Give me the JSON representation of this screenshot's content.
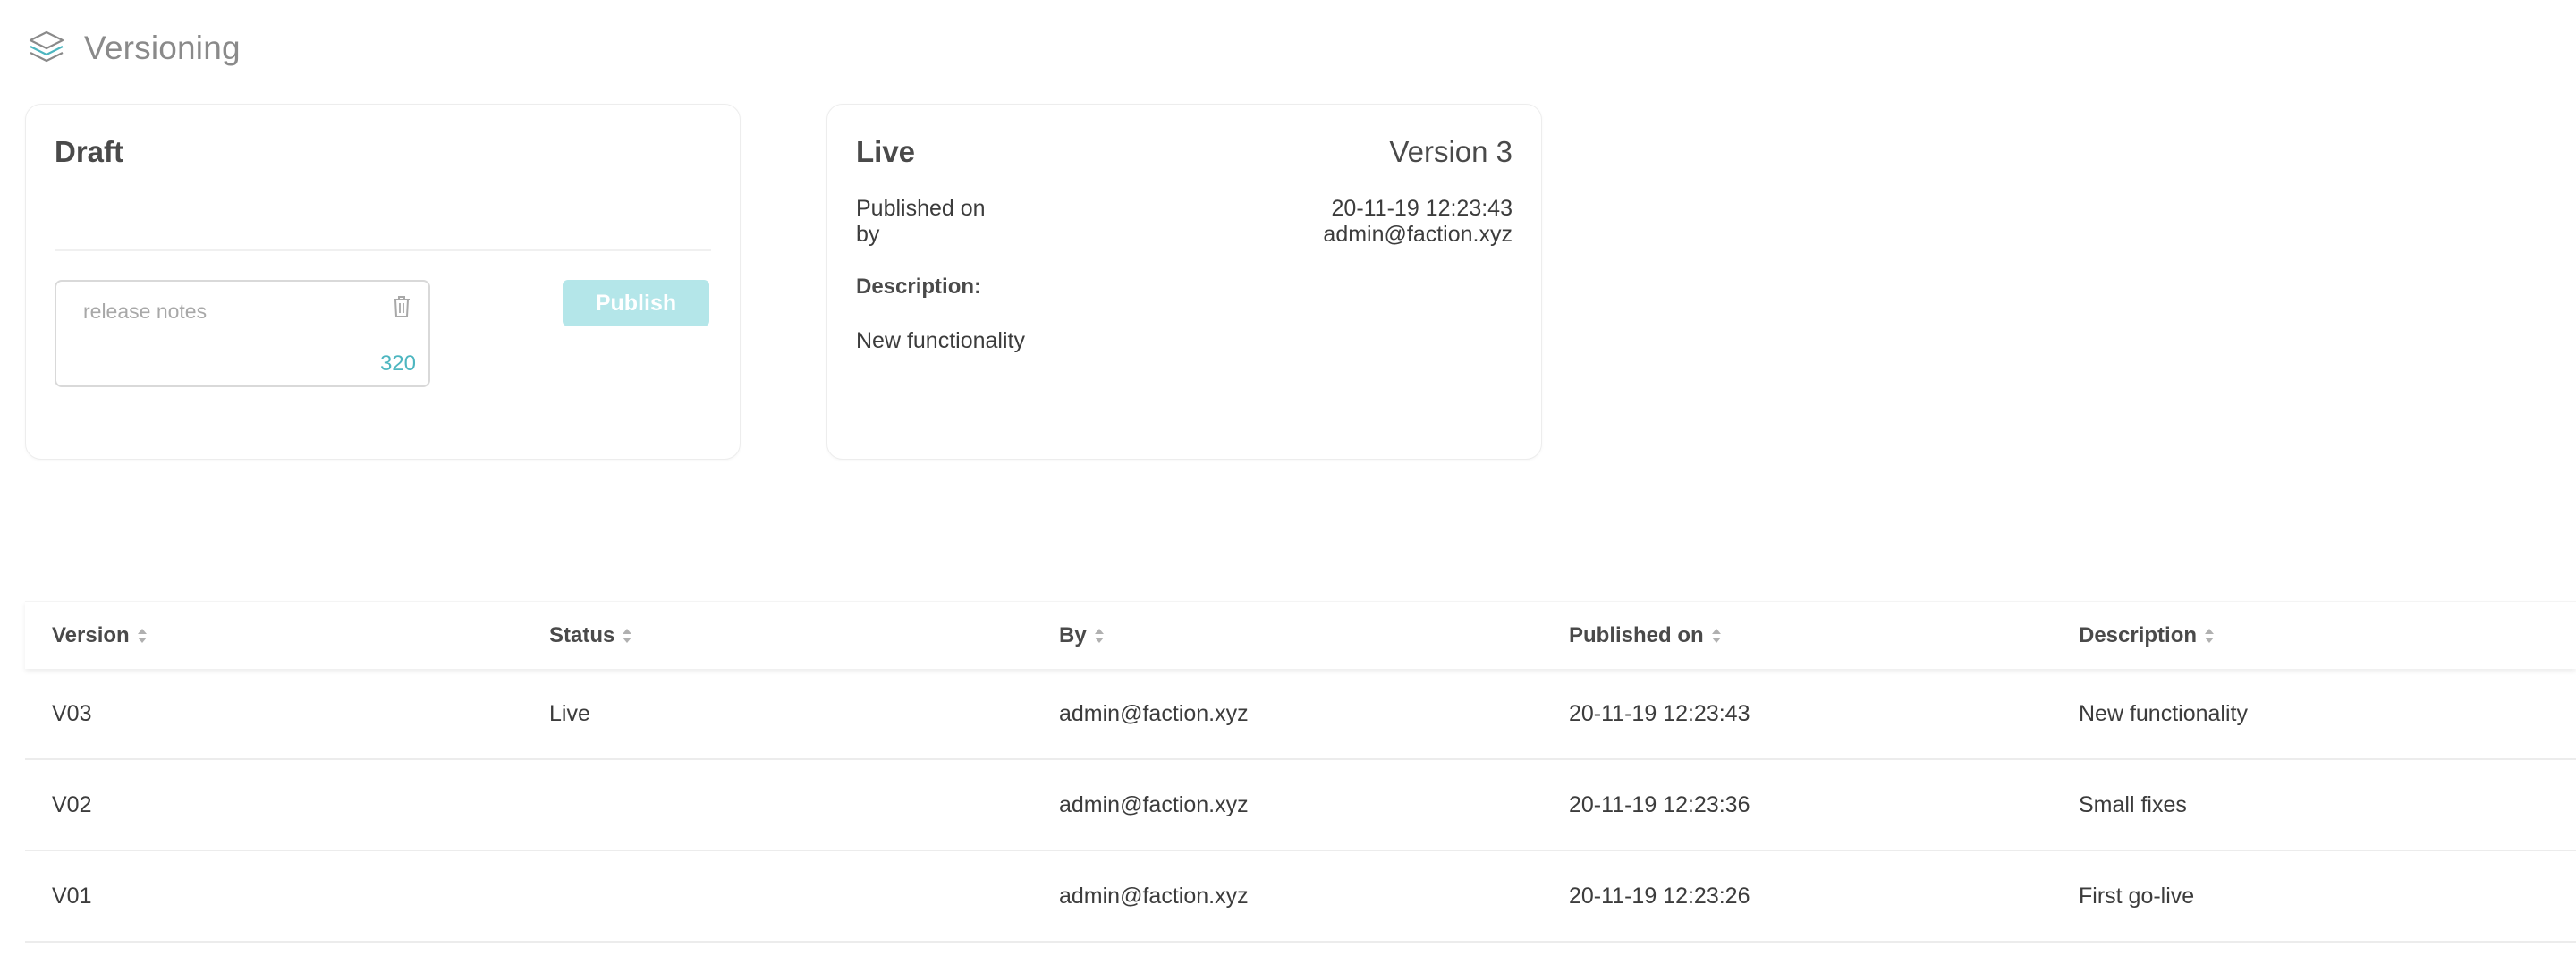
{
  "header": {
    "title": "Versioning",
    "icon": "layers-icon"
  },
  "draft": {
    "title": "Draft",
    "notes_placeholder": "release notes",
    "notes_value": "",
    "notes_remaining": "320",
    "publish_label": "Publish"
  },
  "live": {
    "title": "Live",
    "version": "Version 3",
    "published_label": "Published on",
    "by_label": "by",
    "published_on": "20-11-19 12:23:43",
    "published_by": "admin@faction.xyz",
    "description_label": "Description:",
    "description": "New functionality"
  },
  "table": {
    "columns": [
      "Version",
      "Status",
      "By",
      "Published on",
      "Description"
    ],
    "rows": [
      {
        "version": "V03",
        "status": "Live",
        "by": "admin@faction.xyz",
        "published_on": "20-11-19 12:23:43",
        "description": "New functionality"
      },
      {
        "version": "V02",
        "status": "",
        "by": "admin@faction.xyz",
        "published_on": "20-11-19 12:23:36",
        "description": "Small fixes"
      },
      {
        "version": "V01",
        "status": "",
        "by": "admin@faction.xyz",
        "published_on": "20-11-19 12:23:26",
        "description": "First go-live"
      }
    ]
  },
  "colors": {
    "accent": "#4db6c0",
    "publish_disabled": "#b4e6e9",
    "title_gray": "#8a8a8a"
  }
}
